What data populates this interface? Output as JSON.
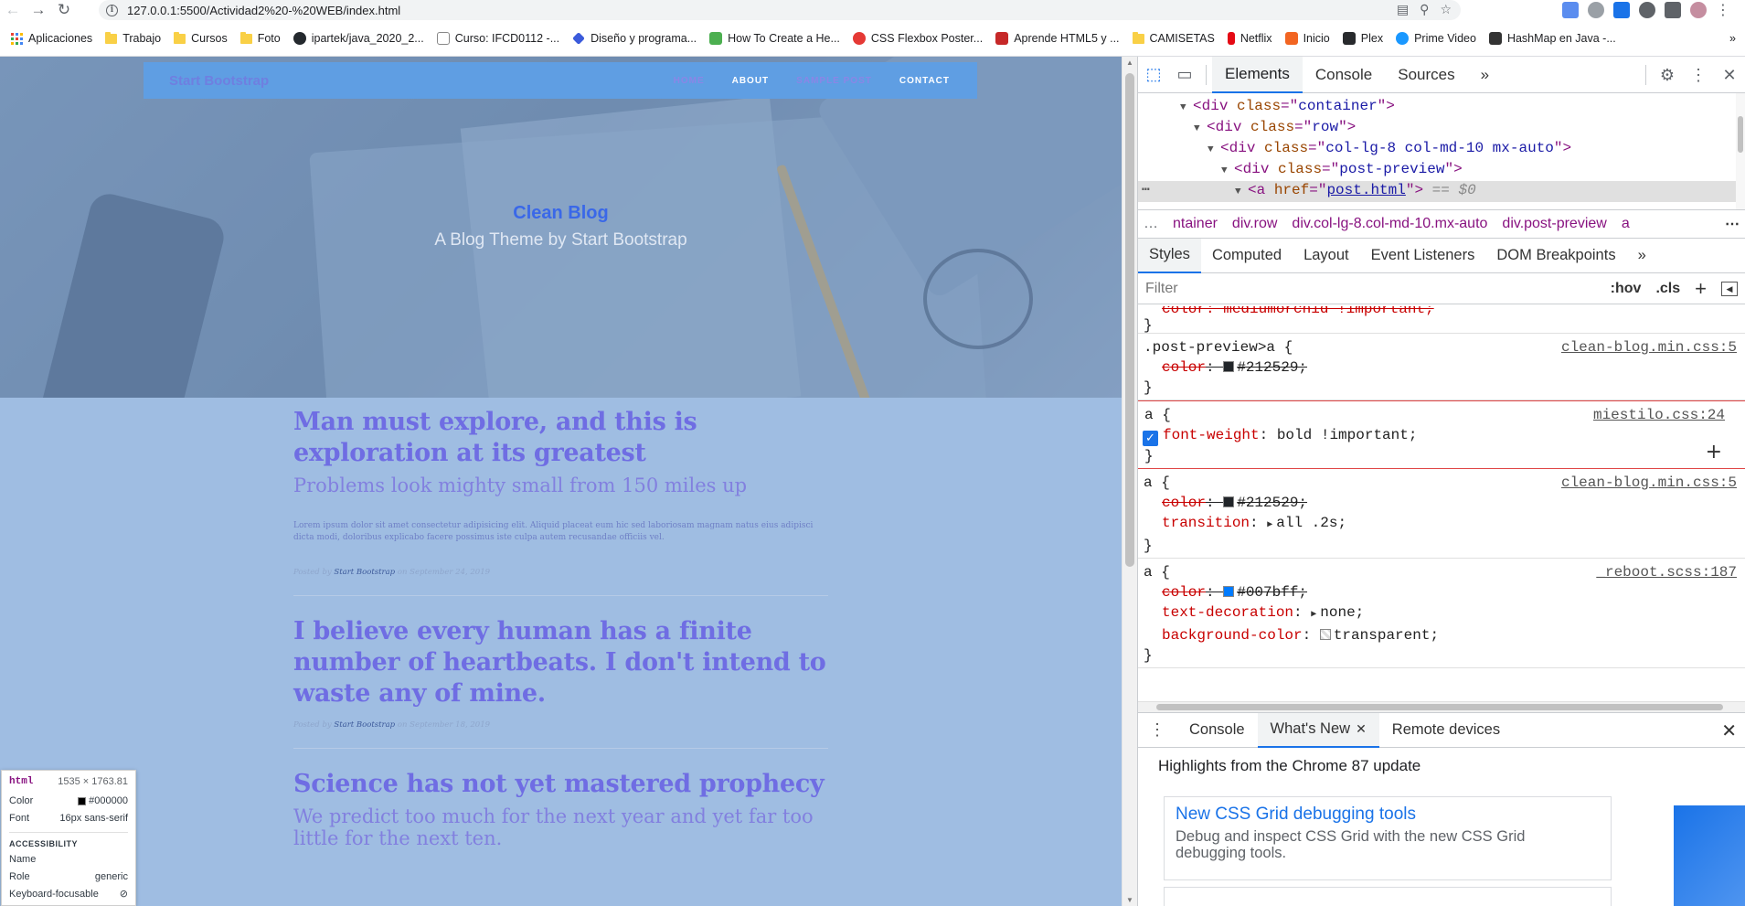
{
  "browser": {
    "url": "127.0.0.1:5500/Actividad2%20-%20WEB/index.html",
    "bookmarks": [
      {
        "label": "Aplicaciones",
        "icon": "apps-grid-icon",
        "color": "#4285f4"
      },
      {
        "label": "Trabajo",
        "icon": "folder-icon",
        "color": "#f9d046"
      },
      {
        "label": "Cursos",
        "icon": "folder-icon",
        "color": "#f9d046"
      },
      {
        "label": "Foto",
        "icon": "folder-icon",
        "color": "#f9d046"
      },
      {
        "label": "ipartek/java_2020_2...",
        "icon": "github-icon",
        "color": "#24292e"
      },
      {
        "label": "Curso: IFCD0112 -...",
        "icon": "course-icon",
        "color": "#5f6368"
      },
      {
        "label": "Diseño y programa...",
        "icon": "diamond-icon",
        "color": "#3b5bdb"
      },
      {
        "label": "How To Create a He...",
        "icon": "code-icon",
        "color": "#4caf50"
      },
      {
        "label": "CSS Flexbox Poster...",
        "icon": "flexbox-icon",
        "color": "#e53935"
      },
      {
        "label": "Aprende HTML5 y ...",
        "icon": "html-icon",
        "color": "#c62828"
      },
      {
        "label": "CAMISETAS",
        "icon": "folder-icon",
        "color": "#f9d046"
      },
      {
        "label": "Netflix",
        "icon": "netflix-icon",
        "color": "#e50914"
      },
      {
        "label": "Inicio",
        "icon": "inicio-icon",
        "color": "#f26522"
      },
      {
        "label": "Plex",
        "icon": "plex-icon",
        "color": "#282a2d"
      },
      {
        "label": "Prime Video",
        "icon": "prime-video-icon",
        "color": "#1a98ff"
      },
      {
        "label": "HashMap en Java -...",
        "icon": "java-icon",
        "color": "#333333"
      }
    ],
    "more_bookmarks": "»"
  },
  "site": {
    "brand": "Start Bootstrap",
    "nav": [
      "HOME",
      "ABOUT",
      "SAMPLE POST",
      "CONTACT"
    ],
    "hero_title": "Clean Blog",
    "hero_subtitle": "A Blog Theme by Start Bootstrap",
    "posts": [
      {
        "title": "Man must explore, and this is exploration at its greatest",
        "subtitle": "Problems look mighty small from 150 miles up",
        "body": "Lorem ipsum dolor sit amet consectetur adipisicing elit. Aliquid placeat eum hic sed laboriosam magnam natus eius adipisci dicta modi, doloribus explicabo facere possimus iste culpa autem recusandae officiis vel.",
        "meta_prefix": "Posted by ",
        "author": "Start Bootstrap",
        "meta_suffix": " on September 24, 2019"
      },
      {
        "title": "I believe every human has a finite number of heartbeats. I don't intend to waste any of mine.",
        "meta_prefix": "Posted by ",
        "author": "Start Bootstrap",
        "meta_suffix": " on September 18, 2019"
      },
      {
        "title": "Science has not yet mastered prophecy",
        "subtitle": "We predict too much for the next year and yet far too little for the next ten."
      }
    ]
  },
  "inspect_tooltip": {
    "tag": "html",
    "dims": "1535 × 1763.81",
    "color_label": "Color",
    "color_value": "#000000",
    "font_label": "Font",
    "font_value": "16px sans-serif",
    "section": "ACCESSIBILITY",
    "name_label": "Name",
    "name_value": "",
    "role_label": "Role",
    "role_value": "generic",
    "focus_label": "Keyboard-focusable"
  },
  "devtools": {
    "tabs": [
      "Elements",
      "Console",
      "Sources"
    ],
    "more": "»",
    "dom": [
      {
        "tag": "div",
        "attr": "class",
        "value": "container"
      },
      {
        "tag": "div",
        "attr": "class",
        "value": "row"
      },
      {
        "tag": "div",
        "attr": "class",
        "value": "col-lg-8 col-md-10 mx-auto"
      },
      {
        "tag": "div",
        "attr": "class",
        "value": "post-preview"
      },
      {
        "tag": "a",
        "attr": "href",
        "value": "post.html",
        "suffix": "== $0"
      }
    ],
    "breadcrumbs": [
      "ntainer",
      "div.row",
      "div.col-lg-8.col-md-10.mx-auto",
      "div.post-preview",
      "a"
    ],
    "sub_tabs": [
      "Styles",
      "Computed",
      "Layout",
      "Event Listeners",
      "DOM Breakpoints"
    ],
    "filter_placeholder": "Filter",
    "hov": ":hov",
    "cls": ".cls",
    "rules": {
      "partial": "color: mediumorchid !important;",
      "r1_selector": ".post-preview>a {",
      "r1_source": "clean-blog.min.css:5",
      "r1_prop": "color",
      "r1_value": "#212529;",
      "r2_selector": "a {",
      "r2_source": "miestilo.css:24",
      "r2_prop": "font-weight",
      "r2_value": "bold !important;",
      "r3_selector": "a {",
      "r3_source": "clean-blog.min.css:5",
      "r3_prop1": "color",
      "r3_val1": "#212529;",
      "r3_prop2": "transition",
      "r3_val2": "all .2s;",
      "r4_selector": "a {",
      "r4_source": "_reboot.scss:187",
      "r4_prop1": "color",
      "r4_val1": "#007bff;",
      "r4_prop2": "text-decoration",
      "r4_val2": "none;",
      "r4_prop3": "background-color",
      "r4_val3": "transparent;",
      "close": "}"
    },
    "drawer_tabs": [
      "Console",
      "What's New",
      "Remote devices"
    ],
    "whats_new_heading": "Highlights from the Chrome 87 update",
    "card_title": "New CSS Grid debugging tools",
    "card_desc": "Debug and inspect CSS Grid with the new CSS Grid debugging tools."
  }
}
